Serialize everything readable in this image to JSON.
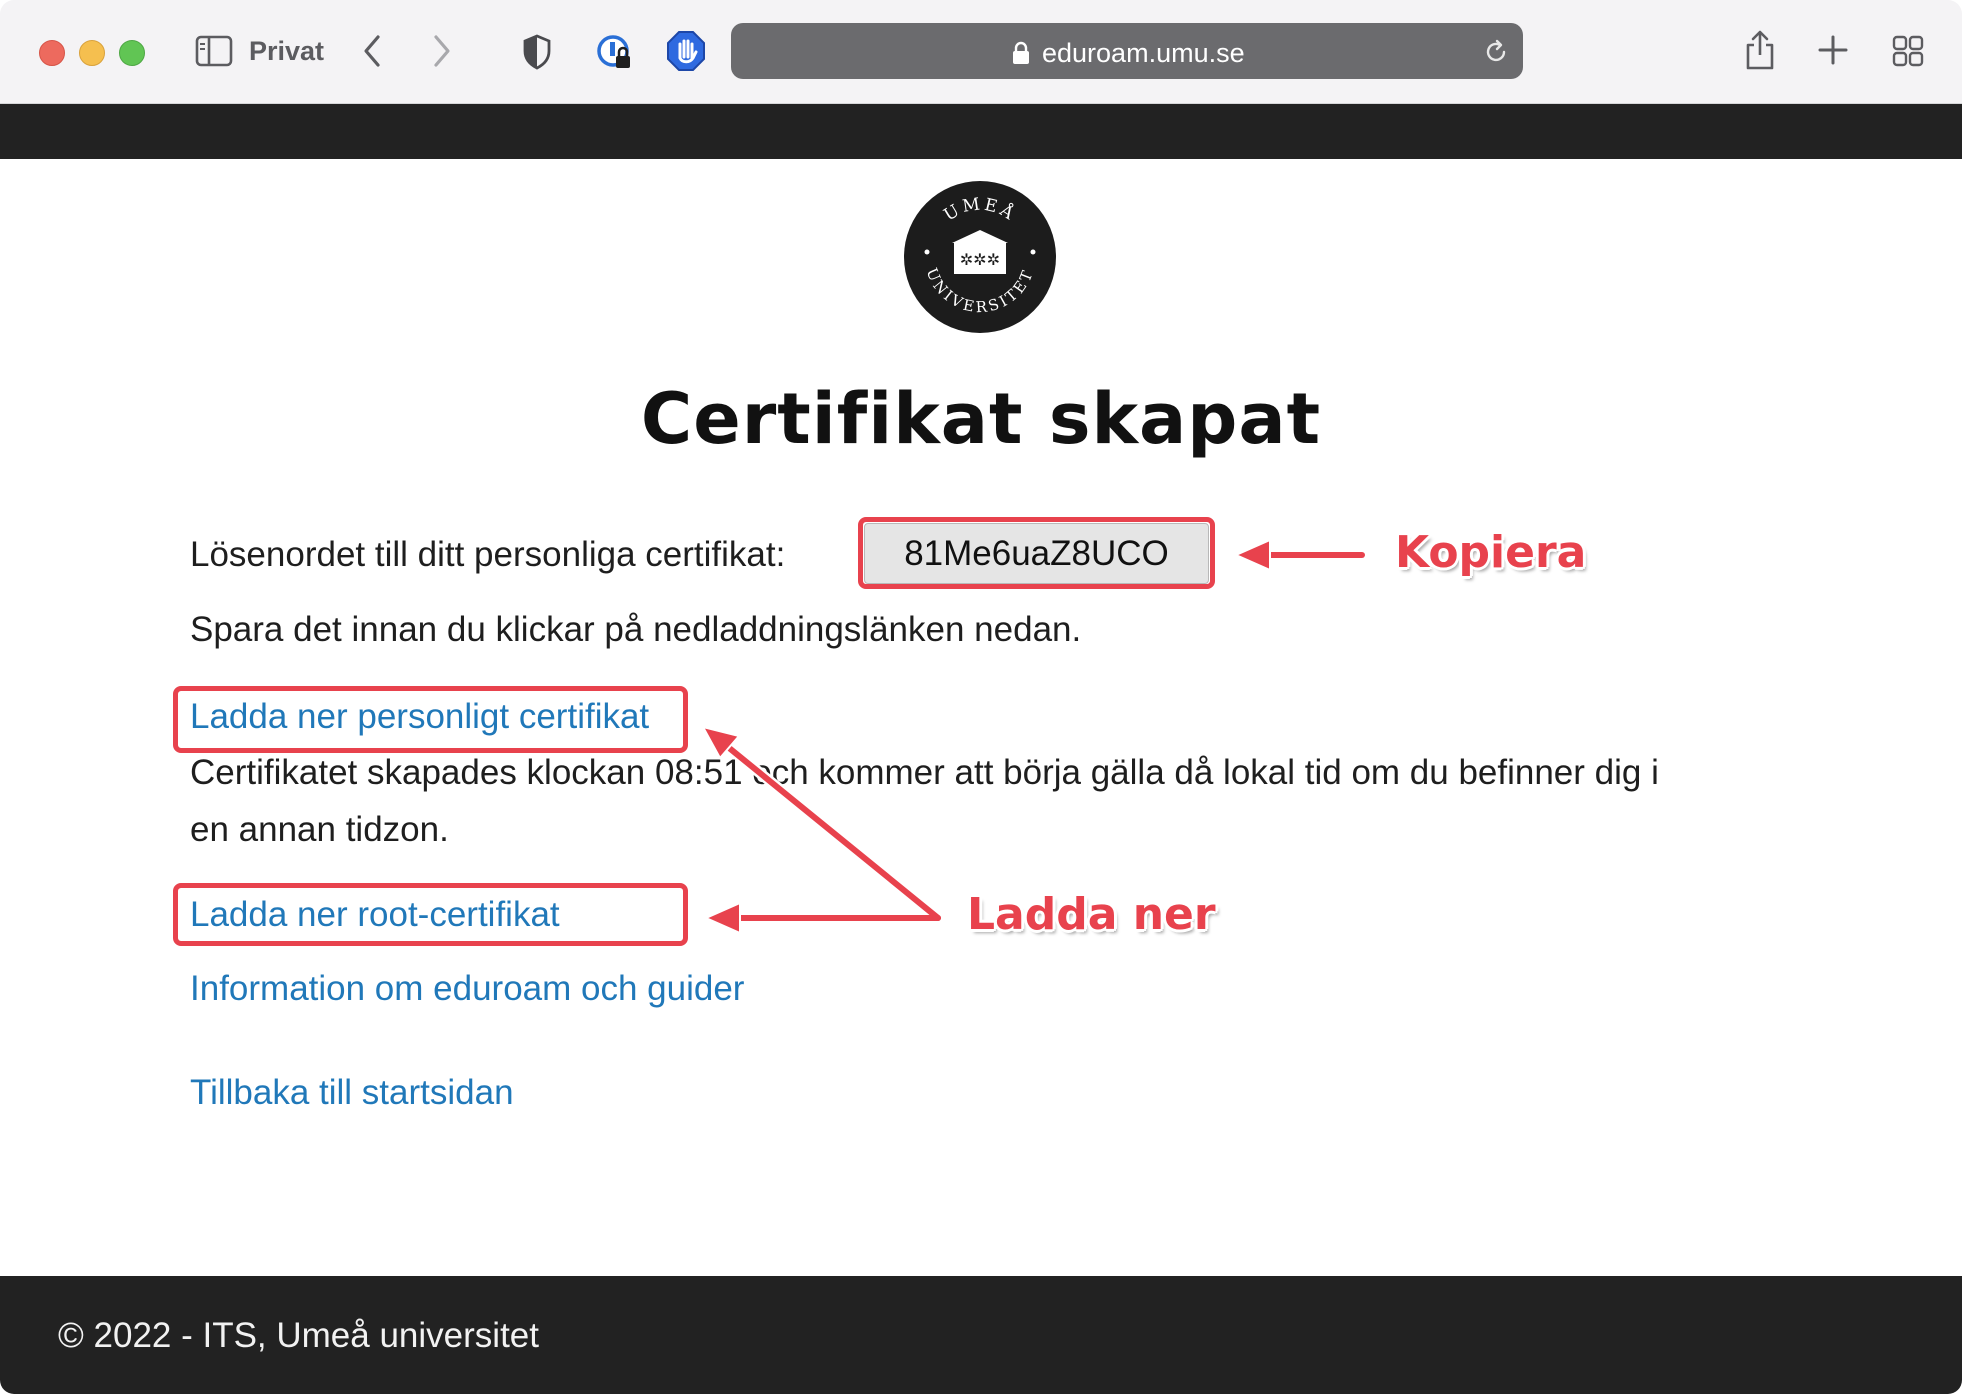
{
  "browser": {
    "mode_label": "Privat",
    "url": "eduroam.umu.se"
  },
  "logo": {
    "text_top": "UMEÅ",
    "text_bottom": "UNIVERSITET"
  },
  "page": {
    "title": "Certifikat skapat",
    "password_label": "Lösenordet till ditt personliga certifikat:",
    "password_value": "81Me6uaZ8UCO",
    "save_note": "Spara det innan du klickar på nedladdningslänken nedan.",
    "download_personal": "Ladda ner personligt certifikat",
    "created_info_line1": "Certifikatet skapades klockan 08:51 och kommer att börja gälla då lokal tid om du befinner dig i",
    "created_info_line2": "en annan tidzon.",
    "download_root": "Ladda ner root-certifikat",
    "info_link": "Information om eduroam och guider",
    "back_link": "Tillbaka till startsidan"
  },
  "annotations": {
    "copy_label": "Kopiera",
    "download_label": "Ladda ner",
    "color": "#e8424d"
  },
  "footer": {
    "text": "© 2022 - ITS, Umeå universitet"
  },
  "colors": {
    "link": "#2078b9",
    "band": "#222222"
  }
}
